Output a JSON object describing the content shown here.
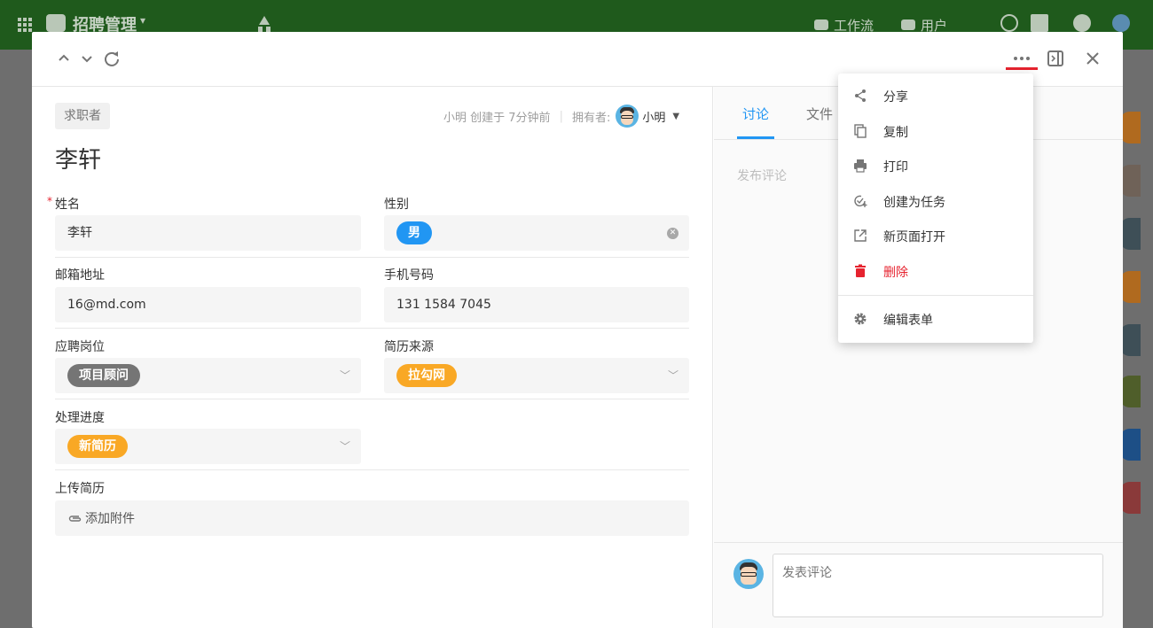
{
  "app": {
    "name": "招聘管理",
    "nav": [
      {
        "label": "工作流"
      },
      {
        "label": "用户"
      }
    ]
  },
  "header": {
    "prev_icon": "chevron-up-icon",
    "next_icon": "chevron-down-icon",
    "refresh_icon": "refresh-icon",
    "more_icon": "more-horizontal-icon",
    "collapse_icon": "sidebar-collapse-icon",
    "close_icon": "close-icon"
  },
  "record": {
    "worksheet": "求职者",
    "title": "李轩",
    "creator": "小明",
    "created": "创建于 7分钟前",
    "owner_label": "拥有者:",
    "owner_name": "小明"
  },
  "fields": {
    "name": {
      "label": "姓名",
      "required_mark": "*",
      "value": "李轩"
    },
    "gender": {
      "label": "性别",
      "value": "男",
      "color": "#2196f3"
    },
    "email": {
      "label": "邮箱地址",
      "value": "16@md.com"
    },
    "phone": {
      "label": "手机号码",
      "value": "131 1584 7045"
    },
    "position": {
      "label": "应聘岗位",
      "value": "项目顾问",
      "color": "#757575"
    },
    "source": {
      "label": "简历来源",
      "value": "拉勾网",
      "color": "#f9a825"
    },
    "progress": {
      "label": "处理进度",
      "value": "新简历",
      "color": "#f9a825"
    },
    "resume": {
      "label": "上传简历",
      "action": "添加附件"
    }
  },
  "side": {
    "tabs": [
      {
        "label": "讨论",
        "active": true
      },
      {
        "label": "文件",
        "active": false
      }
    ],
    "comment_hint": "发布评论",
    "composer_placeholder": "发表评论"
  },
  "menu": {
    "items": [
      {
        "label": "分享",
        "icon": "share-icon"
      },
      {
        "label": "复制",
        "icon": "copy-icon"
      },
      {
        "label": "打印",
        "icon": "print-icon"
      },
      {
        "label": "创建为任务",
        "icon": "task-icon"
      },
      {
        "label": "新页面打开",
        "icon": "open-new-icon"
      },
      {
        "label": "删除",
        "icon": "delete-icon",
        "danger": true
      },
      {
        "label": "编辑表单",
        "icon": "gear-icon"
      }
    ]
  },
  "colors": {
    "accent": "#2196f3",
    "danger": "#e6232f",
    "topbar": "#1f5a1c"
  }
}
